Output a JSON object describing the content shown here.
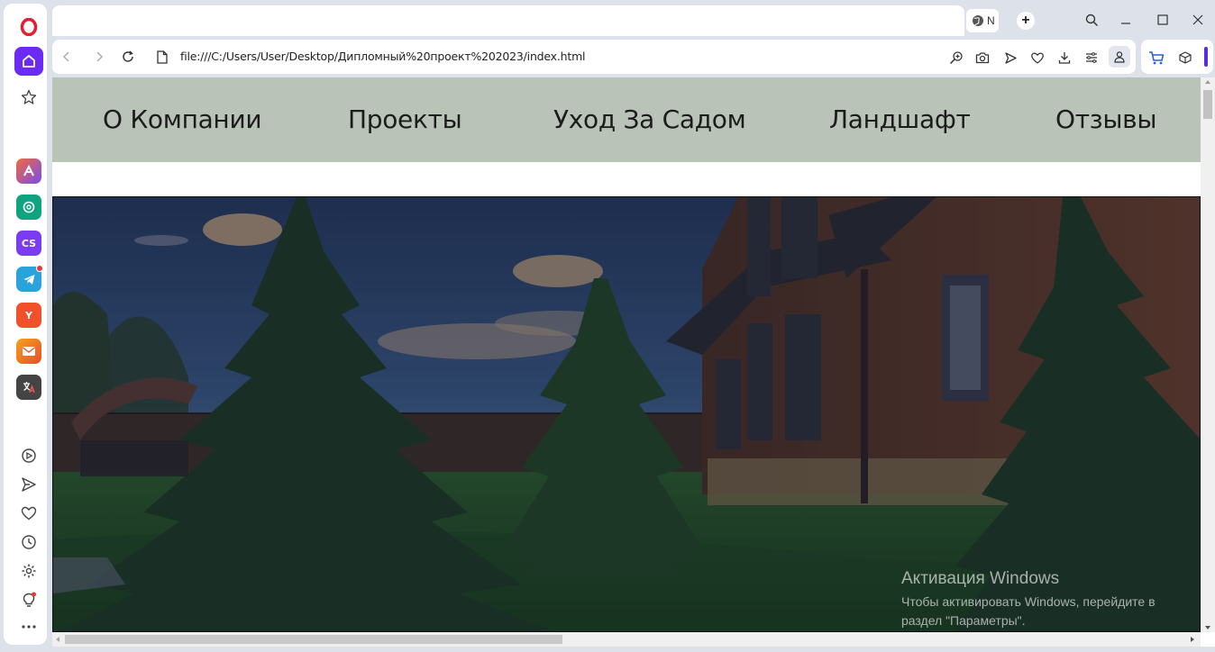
{
  "browser": {
    "tab_title": "N",
    "new_tab": "+",
    "url": "file:///C:/Users/User/Desktop/Дипломный%20проект%202023/index.html"
  },
  "sidebar": {
    "apps": [
      {
        "name": "aria",
        "color": "#e8503a"
      },
      {
        "name": "chatgpt",
        "color": "#10a37f"
      },
      {
        "name": "cs",
        "label": "CS",
        "color": "#7a3cf0"
      },
      {
        "name": "telegram",
        "color": "#2aa3dc"
      },
      {
        "name": "yandex",
        "label": "Y",
        "color": "#f0512a"
      },
      {
        "name": "mail",
        "color": "#f4a21d"
      },
      {
        "name": "translate",
        "color": "#d84a3c"
      }
    ]
  },
  "page": {
    "menu": [
      "О Компании",
      "Проекты",
      "Уход За Садом",
      "Ландшафт",
      "Отзывы"
    ]
  },
  "overlay": {
    "activation_title": "Активация Windows",
    "activation_text": "Чтобы активировать Windows, перейдите в раздел \"Параметры\"."
  }
}
